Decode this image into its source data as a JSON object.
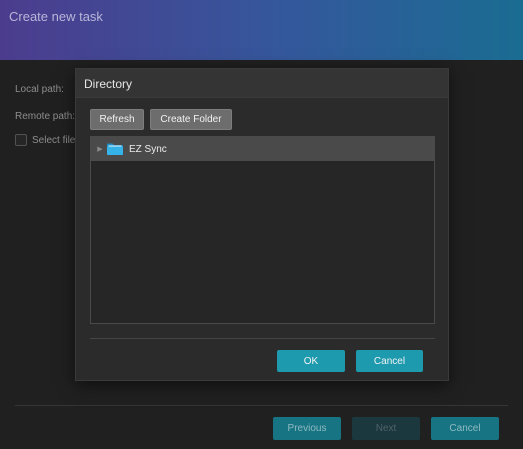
{
  "window": {
    "title": "Create new task"
  },
  "form": {
    "local_path_label": "Local path:",
    "remote_path_label": "Remote path:",
    "select_files_label": "Select file"
  },
  "footer": {
    "previous_label": "Previous",
    "next_label": "Next",
    "cancel_label": "Cancel"
  },
  "dialog": {
    "title": "Directory",
    "refresh_label": "Refresh",
    "create_folder_label": "Create Folder",
    "tree": [
      {
        "label": "EZ Sync",
        "icon": "folder-icon",
        "expanded": false,
        "selected": true
      }
    ],
    "ok_label": "OK",
    "cancel_label": "Cancel"
  },
  "colors": {
    "accent": "#1d9aad",
    "header_start": "#4c3c8e",
    "header_end": "#1a6c92",
    "folder_icon": "#29a7e0"
  }
}
